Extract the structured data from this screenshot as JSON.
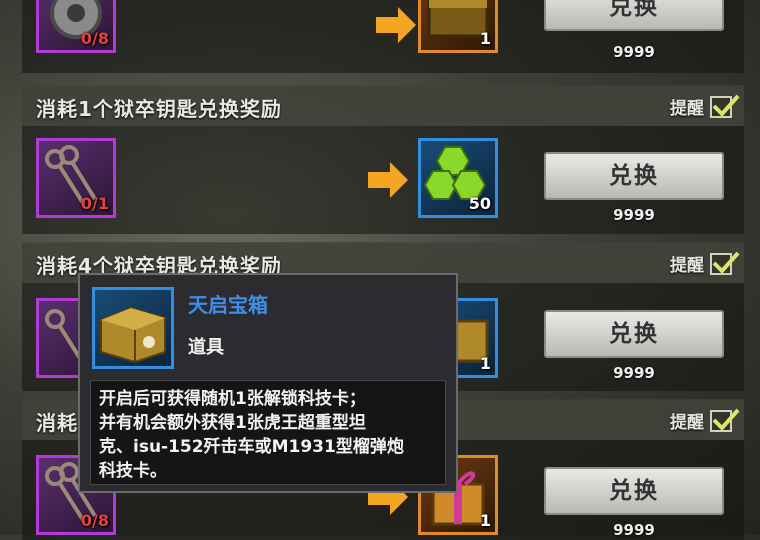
{
  "remind_label": "提醒",
  "exchange_label": "兑换",
  "rows": [
    {
      "title": "",
      "cost_count": "0/8",
      "reward_count": "1",
      "limit": "9999",
      "reward_icon": "crate-icon"
    },
    {
      "title": "消耗1个狱卒钥匙兑换奖励",
      "cost_count": "0/1",
      "reward_count": "50",
      "limit": "9999",
      "reward_icon": "green-gems-icon"
    },
    {
      "title": "消耗4个狱卒钥匙兑换奖励",
      "cost_count": "",
      "reward_count": "1",
      "limit": "9999",
      "reward_icon": "crate-icon"
    },
    {
      "title": "消耗",
      "cost_count": "0/8",
      "reward_count": "1",
      "limit": "9999",
      "reward_icon": "gift-box-icon"
    }
  ],
  "tooltip": {
    "name": "天启宝箱",
    "type": "道具",
    "desc_1": "开启后可获得随机1张解锁科技卡；",
    "desc_2": "并有机会额外获得1张虎王超重型坦",
    "desc_3": "克、isu-152歼击车或M1931型榴弹炮",
    "desc_4": "科技卡。"
  },
  "colors": {
    "cost_border": "#b23bd6",
    "reward_border_blue": "#2f8fe0",
    "reward_border_orange": "#e08a2f",
    "tooltip_title": "#3e8fe6",
    "count_red": "#e0443c"
  }
}
